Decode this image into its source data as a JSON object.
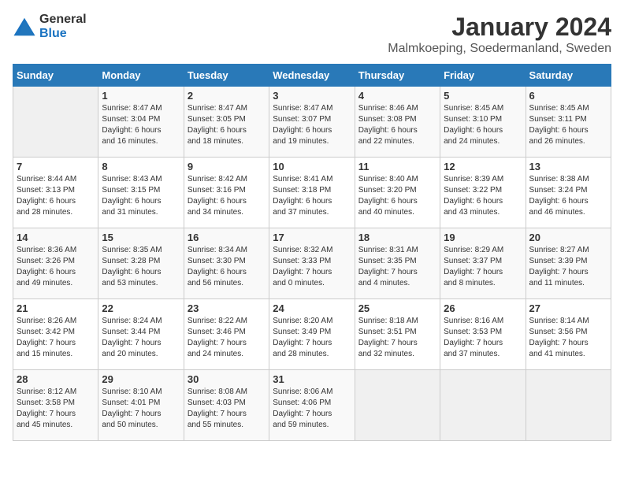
{
  "logo": {
    "general": "General",
    "blue": "Blue"
  },
  "title": "January 2024",
  "location": "Malmkoeping, Soedermanland, Sweden",
  "weekdays": [
    "Sunday",
    "Monday",
    "Tuesday",
    "Wednesday",
    "Thursday",
    "Friday",
    "Saturday"
  ],
  "weeks": [
    [
      {
        "day": "",
        "sunrise": "",
        "sunset": "",
        "daylight": ""
      },
      {
        "day": "1",
        "sunrise": "Sunrise: 8:47 AM",
        "sunset": "Sunset: 3:04 PM",
        "daylight": "Daylight: 6 hours and 16 minutes."
      },
      {
        "day": "2",
        "sunrise": "Sunrise: 8:47 AM",
        "sunset": "Sunset: 3:05 PM",
        "daylight": "Daylight: 6 hours and 18 minutes."
      },
      {
        "day": "3",
        "sunrise": "Sunrise: 8:47 AM",
        "sunset": "Sunset: 3:07 PM",
        "daylight": "Daylight: 6 hours and 19 minutes."
      },
      {
        "day": "4",
        "sunrise": "Sunrise: 8:46 AM",
        "sunset": "Sunset: 3:08 PM",
        "daylight": "Daylight: 6 hours and 22 minutes."
      },
      {
        "day": "5",
        "sunrise": "Sunrise: 8:45 AM",
        "sunset": "Sunset: 3:10 PM",
        "daylight": "Daylight: 6 hours and 24 minutes."
      },
      {
        "day": "6",
        "sunrise": "Sunrise: 8:45 AM",
        "sunset": "Sunset: 3:11 PM",
        "daylight": "Daylight: 6 hours and 26 minutes."
      }
    ],
    [
      {
        "day": "7",
        "sunrise": "Sunrise: 8:44 AM",
        "sunset": "Sunset: 3:13 PM",
        "daylight": "Daylight: 6 hours and 28 minutes."
      },
      {
        "day": "8",
        "sunrise": "Sunrise: 8:43 AM",
        "sunset": "Sunset: 3:15 PM",
        "daylight": "Daylight: 6 hours and 31 minutes."
      },
      {
        "day": "9",
        "sunrise": "Sunrise: 8:42 AM",
        "sunset": "Sunset: 3:16 PM",
        "daylight": "Daylight: 6 hours and 34 minutes."
      },
      {
        "day": "10",
        "sunrise": "Sunrise: 8:41 AM",
        "sunset": "Sunset: 3:18 PM",
        "daylight": "Daylight: 6 hours and 37 minutes."
      },
      {
        "day": "11",
        "sunrise": "Sunrise: 8:40 AM",
        "sunset": "Sunset: 3:20 PM",
        "daylight": "Daylight: 6 hours and 40 minutes."
      },
      {
        "day": "12",
        "sunrise": "Sunrise: 8:39 AM",
        "sunset": "Sunset: 3:22 PM",
        "daylight": "Daylight: 6 hours and 43 minutes."
      },
      {
        "day": "13",
        "sunrise": "Sunrise: 8:38 AM",
        "sunset": "Sunset: 3:24 PM",
        "daylight": "Daylight: 6 hours and 46 minutes."
      }
    ],
    [
      {
        "day": "14",
        "sunrise": "Sunrise: 8:36 AM",
        "sunset": "Sunset: 3:26 PM",
        "daylight": "Daylight: 6 hours and 49 minutes."
      },
      {
        "day": "15",
        "sunrise": "Sunrise: 8:35 AM",
        "sunset": "Sunset: 3:28 PM",
        "daylight": "Daylight: 6 hours and 53 minutes."
      },
      {
        "day": "16",
        "sunrise": "Sunrise: 8:34 AM",
        "sunset": "Sunset: 3:30 PM",
        "daylight": "Daylight: 6 hours and 56 minutes."
      },
      {
        "day": "17",
        "sunrise": "Sunrise: 8:32 AM",
        "sunset": "Sunset: 3:33 PM",
        "daylight": "Daylight: 7 hours and 0 minutes."
      },
      {
        "day": "18",
        "sunrise": "Sunrise: 8:31 AM",
        "sunset": "Sunset: 3:35 PM",
        "daylight": "Daylight: 7 hours and 4 minutes."
      },
      {
        "day": "19",
        "sunrise": "Sunrise: 8:29 AM",
        "sunset": "Sunset: 3:37 PM",
        "daylight": "Daylight: 7 hours and 8 minutes."
      },
      {
        "day": "20",
        "sunrise": "Sunrise: 8:27 AM",
        "sunset": "Sunset: 3:39 PM",
        "daylight": "Daylight: 7 hours and 11 minutes."
      }
    ],
    [
      {
        "day": "21",
        "sunrise": "Sunrise: 8:26 AM",
        "sunset": "Sunset: 3:42 PM",
        "daylight": "Daylight: 7 hours and 15 minutes."
      },
      {
        "day": "22",
        "sunrise": "Sunrise: 8:24 AM",
        "sunset": "Sunset: 3:44 PM",
        "daylight": "Daylight: 7 hours and 20 minutes."
      },
      {
        "day": "23",
        "sunrise": "Sunrise: 8:22 AM",
        "sunset": "Sunset: 3:46 PM",
        "daylight": "Daylight: 7 hours and 24 minutes."
      },
      {
        "day": "24",
        "sunrise": "Sunrise: 8:20 AM",
        "sunset": "Sunset: 3:49 PM",
        "daylight": "Daylight: 7 hours and 28 minutes."
      },
      {
        "day": "25",
        "sunrise": "Sunrise: 8:18 AM",
        "sunset": "Sunset: 3:51 PM",
        "daylight": "Daylight: 7 hours and 32 minutes."
      },
      {
        "day": "26",
        "sunrise": "Sunrise: 8:16 AM",
        "sunset": "Sunset: 3:53 PM",
        "daylight": "Daylight: 7 hours and 37 minutes."
      },
      {
        "day": "27",
        "sunrise": "Sunrise: 8:14 AM",
        "sunset": "Sunset: 3:56 PM",
        "daylight": "Daylight: 7 hours and 41 minutes."
      }
    ],
    [
      {
        "day": "28",
        "sunrise": "Sunrise: 8:12 AM",
        "sunset": "Sunset: 3:58 PM",
        "daylight": "Daylight: 7 hours and 45 minutes."
      },
      {
        "day": "29",
        "sunrise": "Sunrise: 8:10 AM",
        "sunset": "Sunset: 4:01 PM",
        "daylight": "Daylight: 7 hours and 50 minutes."
      },
      {
        "day": "30",
        "sunrise": "Sunrise: 8:08 AM",
        "sunset": "Sunset: 4:03 PM",
        "daylight": "Daylight: 7 hours and 55 minutes."
      },
      {
        "day": "31",
        "sunrise": "Sunrise: 8:06 AM",
        "sunset": "Sunset: 4:06 PM",
        "daylight": "Daylight: 7 hours and 59 minutes."
      },
      {
        "day": "",
        "sunrise": "",
        "sunset": "",
        "daylight": ""
      },
      {
        "day": "",
        "sunrise": "",
        "sunset": "",
        "daylight": ""
      },
      {
        "day": "",
        "sunrise": "",
        "sunset": "",
        "daylight": ""
      }
    ]
  ]
}
